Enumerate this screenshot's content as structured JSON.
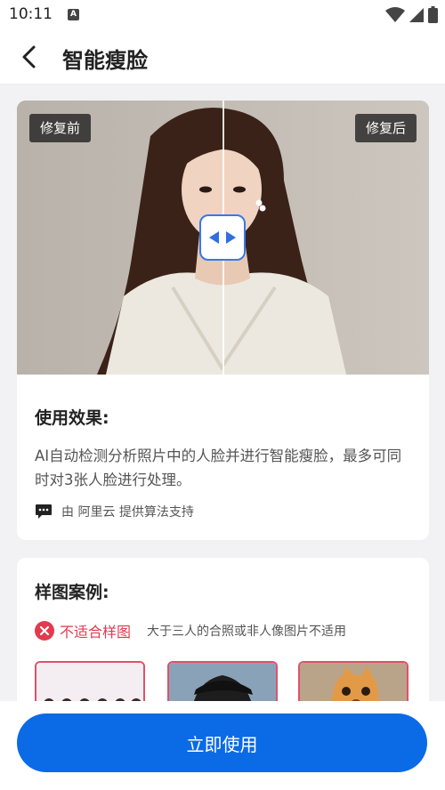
{
  "status_bar": {
    "time": "10:11",
    "notification_badge": "A"
  },
  "header": {
    "title": "智能瘦脸",
    "back_icon": "chevron-left-icon"
  },
  "comparison": {
    "before_label": "修复前",
    "after_label": "修复后",
    "handle_icon": "left-right-arrows-icon",
    "accent_color": "#3a78e8"
  },
  "usage": {
    "title": "使用效果:",
    "description": "AI自动检测分析照片中的人脸并进行智能瘦脸，最多可同时对3张人脸进行处理。",
    "provider_icon": "chat-bubble-icon",
    "provider_text": "由 阿里云 提供算法支持"
  },
  "examples": {
    "title": "样图案例:",
    "unsuitable_icon": "close-circle-icon",
    "unsuitable_label": "不适合样图",
    "unsuitable_desc": "大于三人的合照或非人像图片不适用",
    "unsuitable_color": "#e23a4e"
  },
  "action": {
    "button_label": "立即使用",
    "button_color": "#0b6ae6"
  }
}
